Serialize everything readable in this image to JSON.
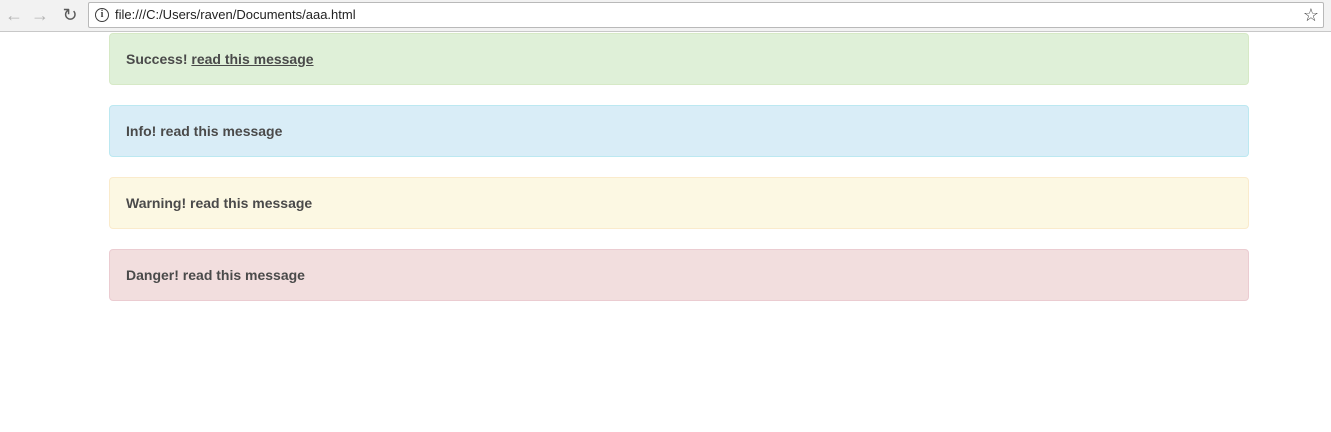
{
  "browser": {
    "back_icon": "arrow-left-icon",
    "forward_icon": "arrow-right-icon",
    "reload_icon": "reload-icon",
    "info_icon": "info-icon",
    "bookmark_icon": "star-icon",
    "url": "file:///C:/Users/raven/Documents/aaa.html"
  },
  "alerts": {
    "success": {
      "label": "Success!",
      "link_text": "read this message",
      "bg": "#dff0d8"
    },
    "info": {
      "label": "Info!",
      "message": "read this message",
      "bg": "#d9edf7"
    },
    "warning": {
      "label": "Warning!",
      "message": "read this message",
      "bg": "#fcf8e3"
    },
    "danger": {
      "label": "Danger!",
      "message": "read this message",
      "bg": "#f2dede"
    }
  }
}
